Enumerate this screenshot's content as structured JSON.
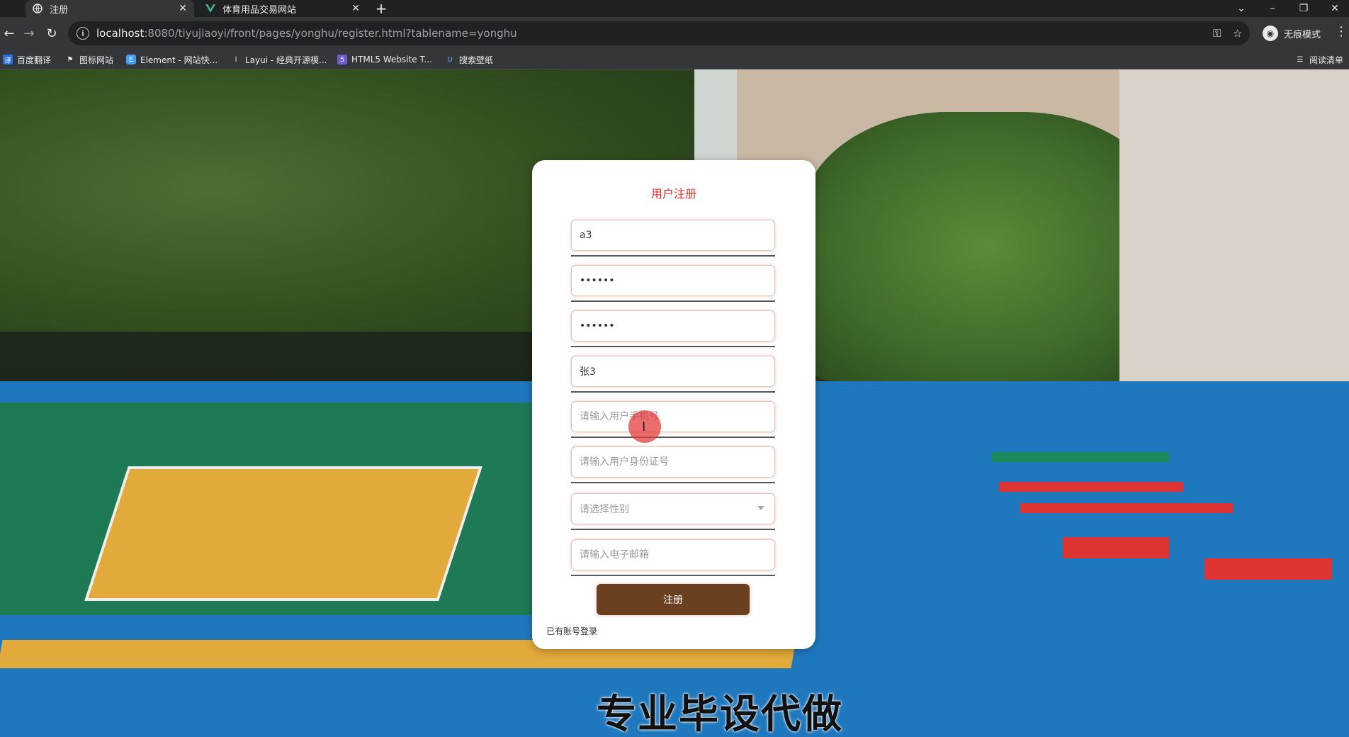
{
  "browser": {
    "tabs": [
      {
        "title": "注册",
        "active": true
      },
      {
        "title": "体育用品交易网站",
        "active": false
      }
    ],
    "url_host": "localhost",
    "url_rest": ":8080/tiyujiaoyi/front/pages/yonghu/register.html?tablename=yonghu",
    "profile_label": "无痕模式",
    "bookmarks": [
      "百度翻译",
      "图标网站",
      "Element - 网站快...",
      "Layui - 经典开源模...",
      "HTML5 Website T...",
      "搜索壁纸"
    ],
    "reading_list": "阅读清单"
  },
  "form": {
    "title": "用户注册",
    "username_value": "a3",
    "password_value": "••••••",
    "confirm_password_value": "••••••",
    "name_value": "张3",
    "phone_placeholder": "请输入用户手机号",
    "idcard_placeholder": "请输入用户身份证号",
    "gender_placeholder": "请选择性别",
    "email_placeholder": "请输入电子邮箱",
    "submit_label": "注册",
    "login_link": "已有账号登录"
  },
  "watermark": "专业毕设代做"
}
